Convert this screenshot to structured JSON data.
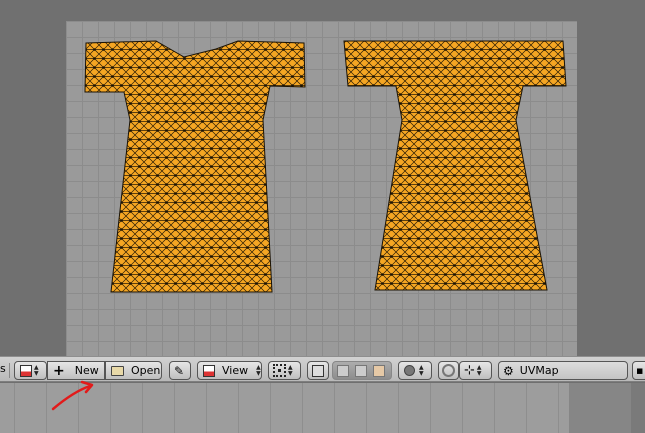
{
  "header": {
    "new_label": "New",
    "open_label": "Open",
    "view_label": "View",
    "uvmap_name": "UVMap",
    "left_edge_glyph": "s"
  },
  "icons": [
    "image-icon",
    "plus-icon",
    "folder-icon",
    "pin-icon",
    "view-menu-icon",
    "pivot-icon",
    "sync-selection-icon",
    "vertex-select-icon",
    "edge-select-icon",
    "face-select-icon",
    "proportional-icon",
    "uv-sync-icon",
    "snap-icon",
    "uv-layer-icon"
  ],
  "colors": {
    "mesh_fill": "#f5a623",
    "mesh_wire": "#1a1204",
    "annotation_arrow": "#e21a1a"
  }
}
